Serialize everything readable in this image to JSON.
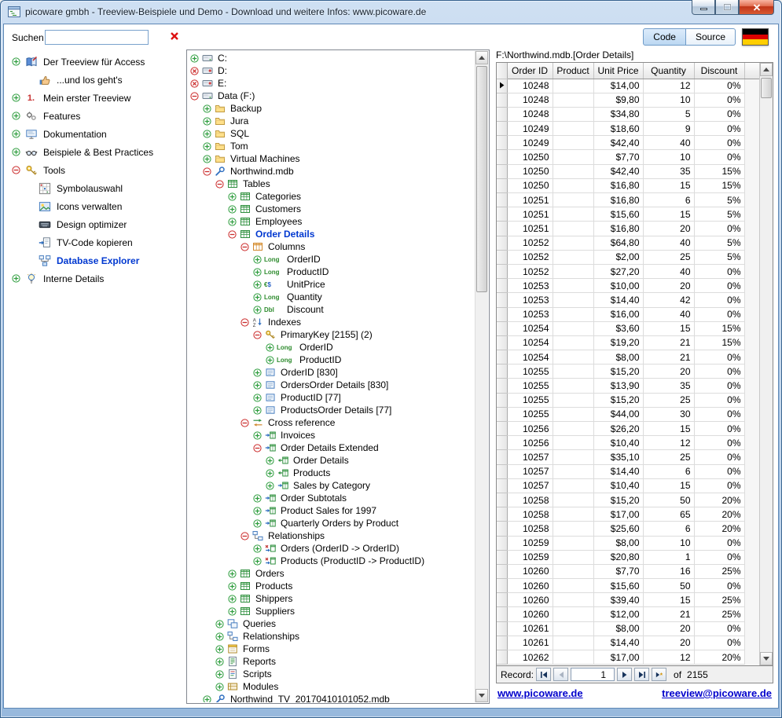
{
  "window": {
    "title": "picoware gmbh - Treeview-Beispiele und Demo - Download und weitere Infos:  www.picoware.de"
  },
  "toolbar": {
    "search_label": "Suchen",
    "search_value": "",
    "code_label": "Code",
    "source_label": "Source"
  },
  "colors": {
    "selected_text": "#0038d0",
    "expander_collapsed": "#2e9e3e",
    "expander_expanded": "#cc2b2b",
    "link": "#0000cc",
    "flag_stripes": [
      "#000000",
      "#dd0000",
      "#ffce00"
    ]
  },
  "sidebar": {
    "items": [
      {
        "label": "Der Treeview für Access",
        "expander": "plus",
        "icon": "treeview-book",
        "level": 0
      },
      {
        "label": "...und los geht's",
        "expander": "none",
        "icon": "thumbs-up",
        "level": 1
      },
      {
        "label": "Mein erster Treeview",
        "expander": "plus",
        "icon": "number-one",
        "icon_text": "1.",
        "level": 0
      },
      {
        "label": "Features",
        "expander": "plus",
        "icon": "features",
        "level": 0
      },
      {
        "label": "Dokumentation",
        "expander": "plus",
        "icon": "documentation",
        "level": 0
      },
      {
        "label": "Beispiele & Best Practices",
        "expander": "plus",
        "icon": "examples",
        "level": 0
      },
      {
        "label": "Tools",
        "expander": "minus",
        "icon": "tools",
        "level": 0
      },
      {
        "label": "Symbolauswahl",
        "expander": "none",
        "icon": "symbols",
        "level": 1
      },
      {
        "label": "Icons verwalten",
        "expander": "none",
        "icon": "icons-manage",
        "level": 1
      },
      {
        "label": "Design optimizer",
        "expander": "none",
        "icon": "design",
        "level": 1
      },
      {
        "label": "TV-Code kopieren",
        "expander": "none",
        "icon": "copy-code",
        "level": 1
      },
      {
        "label": "Database Explorer",
        "expander": "none",
        "icon": "database-explorer",
        "level": 1,
        "selected": true
      },
      {
        "label": "Interne Details",
        "expander": "plus",
        "icon": "lamp",
        "level": 0
      }
    ]
  },
  "tree": {
    "type_badges": {
      "long": "Long",
      "currency": "€$",
      "double": "Dbl"
    },
    "items": [
      {
        "level": 0,
        "expander": "plus",
        "icon": "drive",
        "label": "C:"
      },
      {
        "level": 0,
        "expander": "xmark",
        "icon": "cdrom",
        "label": "D:"
      },
      {
        "level": 0,
        "expander": "xmark",
        "icon": "cdrom",
        "label": "E:"
      },
      {
        "level": 0,
        "expander": "minus",
        "icon": "drive",
        "label": "Data (F:)"
      },
      {
        "level": 1,
        "expander": "plus",
        "icon": "folder",
        "label": "Backup"
      },
      {
        "level": 1,
        "expander": "plus",
        "icon": "folder",
        "label": "Jura"
      },
      {
        "level": 1,
        "expander": "plus",
        "icon": "folder",
        "label": "SQL"
      },
      {
        "level": 1,
        "expander": "plus",
        "icon": "folder",
        "label": "Tom"
      },
      {
        "level": 1,
        "expander": "plus",
        "icon": "folder",
        "label": "Virtual Machines"
      },
      {
        "level": 1,
        "expander": "minus",
        "icon": "database",
        "label": "Northwind.mdb"
      },
      {
        "level": 2,
        "expander": "minus",
        "icon": "table",
        "label": "Tables"
      },
      {
        "level": 3,
        "expander": "plus",
        "icon": "table",
        "label": "Categories"
      },
      {
        "level": 3,
        "expander": "plus",
        "icon": "table",
        "label": "Customers"
      },
      {
        "level": 3,
        "expander": "plus",
        "icon": "table",
        "label": "Employees"
      },
      {
        "level": 3,
        "expander": "minus",
        "icon": "table",
        "label": "Order Details",
        "selected": true
      },
      {
        "level": 4,
        "expander": "minus",
        "icon": "columns",
        "label": "Columns"
      },
      {
        "level": 5,
        "expander": "plus",
        "icon": "type-long",
        "label": "OrderID"
      },
      {
        "level": 5,
        "expander": "plus",
        "icon": "type-long",
        "label": "ProductID"
      },
      {
        "level": 5,
        "expander": "plus",
        "icon": "type-currency",
        "label": "UnitPrice"
      },
      {
        "level": 5,
        "expander": "plus",
        "icon": "type-long",
        "label": "Quantity"
      },
      {
        "level": 5,
        "expander": "plus",
        "icon": "type-double",
        "label": "Discount"
      },
      {
        "level": 4,
        "expander": "minus",
        "icon": "indexes",
        "label": "Indexes"
      },
      {
        "level": 5,
        "expander": "minus",
        "icon": "key",
        "label": "PrimaryKey [2155] (2)"
      },
      {
        "level": 6,
        "expander": "plus",
        "icon": "type-long",
        "label": "OrderID"
      },
      {
        "level": 6,
        "expander": "plus",
        "icon": "type-long",
        "label": "ProductID"
      },
      {
        "level": 5,
        "expander": "plus",
        "icon": "index",
        "label": "OrderID [830]"
      },
      {
        "level": 5,
        "expander": "plus",
        "icon": "index",
        "label": "OrdersOrder Details [830]"
      },
      {
        "level": 5,
        "expander": "plus",
        "icon": "index",
        "label": "ProductID [77]"
      },
      {
        "level": 5,
        "expander": "plus",
        "icon": "index",
        "label": "ProductsOrder Details [77]"
      },
      {
        "level": 4,
        "expander": "minus",
        "icon": "crossref",
        "label": "Cross reference"
      },
      {
        "level": 5,
        "expander": "plus",
        "icon": "query-right",
        "label": "Invoices"
      },
      {
        "level": 5,
        "expander": "minus",
        "icon": "query-right",
        "label": "Order Details Extended"
      },
      {
        "level": 6,
        "expander": "plus",
        "icon": "query-left",
        "label": "Order Details"
      },
      {
        "level": 6,
        "expander": "plus",
        "icon": "query-left",
        "label": "Products"
      },
      {
        "level": 6,
        "expander": "plus",
        "icon": "query-right",
        "label": "Sales by Category"
      },
      {
        "level": 5,
        "expander": "plus",
        "icon": "query-right",
        "label": "Order Subtotals"
      },
      {
        "level": 5,
        "expander": "plus",
        "icon": "query-right",
        "label": "Product Sales for 1997"
      },
      {
        "level": 5,
        "expander": "plus",
        "icon": "query-right",
        "label": "Quarterly Orders by Product"
      },
      {
        "level": 4,
        "expander": "minus",
        "icon": "relationship",
        "label": "Relationships"
      },
      {
        "level": 5,
        "expander": "plus",
        "icon": "relation-arrow",
        "label": "Orders (OrderID -> OrderID)"
      },
      {
        "level": 5,
        "expander": "plus",
        "icon": "relation-arrow",
        "label": "Products (ProductID -> ProductID)"
      },
      {
        "level": 3,
        "expander": "plus",
        "icon": "table",
        "label": "Orders"
      },
      {
        "level": 3,
        "expander": "plus",
        "icon": "table",
        "label": "Products"
      },
      {
        "level": 3,
        "expander": "plus",
        "icon": "table",
        "label": "Shippers"
      },
      {
        "level": 3,
        "expander": "plus",
        "icon": "table",
        "label": "Suppliers"
      },
      {
        "level": 2,
        "expander": "plus",
        "icon": "queries",
        "label": "Queries"
      },
      {
        "level": 2,
        "expander": "plus",
        "icon": "relationship",
        "label": "Relationships"
      },
      {
        "level": 2,
        "expander": "plus",
        "icon": "form",
        "label": "Forms"
      },
      {
        "level": 2,
        "expander": "plus",
        "icon": "report",
        "label": "Reports"
      },
      {
        "level": 2,
        "expander": "plus",
        "icon": "script",
        "label": "Scripts"
      },
      {
        "level": 2,
        "expander": "plus",
        "icon": "module",
        "label": "Modules"
      },
      {
        "level": 1,
        "expander": "plus",
        "icon": "database",
        "label": "Northwind_TV_20170410101052.mdb"
      }
    ]
  },
  "grid": {
    "title": "F:\\Northwind.mdb.[Order Details]",
    "columns": [
      "Order ID",
      "Product",
      "Unit Price",
      "Quantity",
      "Discount"
    ],
    "rows": [
      [
        "10248",
        "",
        "$14,00",
        "12",
        "0%"
      ],
      [
        "10248",
        "",
        "$9,80",
        "10",
        "0%"
      ],
      [
        "10248",
        "",
        "$34,80",
        "5",
        "0%"
      ],
      [
        "10249",
        "",
        "$18,60",
        "9",
        "0%"
      ],
      [
        "10249",
        "",
        "$42,40",
        "40",
        "0%"
      ],
      [
        "10250",
        "",
        "$7,70",
        "10",
        "0%"
      ],
      [
        "10250",
        "",
        "$42,40",
        "35",
        "15%"
      ],
      [
        "10250",
        "",
        "$16,80",
        "15",
        "15%"
      ],
      [
        "10251",
        "",
        "$16,80",
        "6",
        "5%"
      ],
      [
        "10251",
        "",
        "$15,60",
        "15",
        "5%"
      ],
      [
        "10251",
        "",
        "$16,80",
        "20",
        "0%"
      ],
      [
        "10252",
        "",
        "$64,80",
        "40",
        "5%"
      ],
      [
        "10252",
        "",
        "$2,00",
        "25",
        "5%"
      ],
      [
        "10252",
        "",
        "$27,20",
        "40",
        "0%"
      ],
      [
        "10253",
        "",
        "$10,00",
        "20",
        "0%"
      ],
      [
        "10253",
        "",
        "$14,40",
        "42",
        "0%"
      ],
      [
        "10253",
        "",
        "$16,00",
        "40",
        "0%"
      ],
      [
        "10254",
        "",
        "$3,60",
        "15",
        "15%"
      ],
      [
        "10254",
        "",
        "$19,20",
        "21",
        "15%"
      ],
      [
        "10254",
        "",
        "$8,00",
        "21",
        "0%"
      ],
      [
        "10255",
        "",
        "$15,20",
        "20",
        "0%"
      ],
      [
        "10255",
        "",
        "$13,90",
        "35",
        "0%"
      ],
      [
        "10255",
        "",
        "$15,20",
        "25",
        "0%"
      ],
      [
        "10255",
        "",
        "$44,00",
        "30",
        "0%"
      ],
      [
        "10256",
        "",
        "$26,20",
        "15",
        "0%"
      ],
      [
        "10256",
        "",
        "$10,40",
        "12",
        "0%"
      ],
      [
        "10257",
        "",
        "$35,10",
        "25",
        "0%"
      ],
      [
        "10257",
        "",
        "$14,40",
        "6",
        "0%"
      ],
      [
        "10257",
        "",
        "$10,40",
        "15",
        "0%"
      ],
      [
        "10258",
        "",
        "$15,20",
        "50",
        "20%"
      ],
      [
        "10258",
        "",
        "$17,00",
        "65",
        "20%"
      ],
      [
        "10258",
        "",
        "$25,60",
        "6",
        "20%"
      ],
      [
        "10259",
        "",
        "$8,00",
        "10",
        "0%"
      ],
      [
        "10259",
        "",
        "$20,80",
        "1",
        "0%"
      ],
      [
        "10260",
        "",
        "$7,70",
        "16",
        "25%"
      ],
      [
        "10260",
        "",
        "$15,60",
        "50",
        "0%"
      ],
      [
        "10260",
        "",
        "$39,40",
        "15",
        "25%"
      ],
      [
        "10260",
        "",
        "$12,00",
        "21",
        "25%"
      ],
      [
        "10261",
        "",
        "$8,00",
        "20",
        "0%"
      ],
      [
        "10261",
        "",
        "$14,40",
        "20",
        "0%"
      ],
      [
        "10262",
        "",
        "$17,00",
        "12",
        "20%"
      ]
    ]
  },
  "recordbar": {
    "label": "Record:",
    "value": "1",
    "of_label": "of",
    "total": "2155"
  },
  "footer": {
    "site": "www.picoware.de",
    "email": "treeview@picoware.de"
  }
}
